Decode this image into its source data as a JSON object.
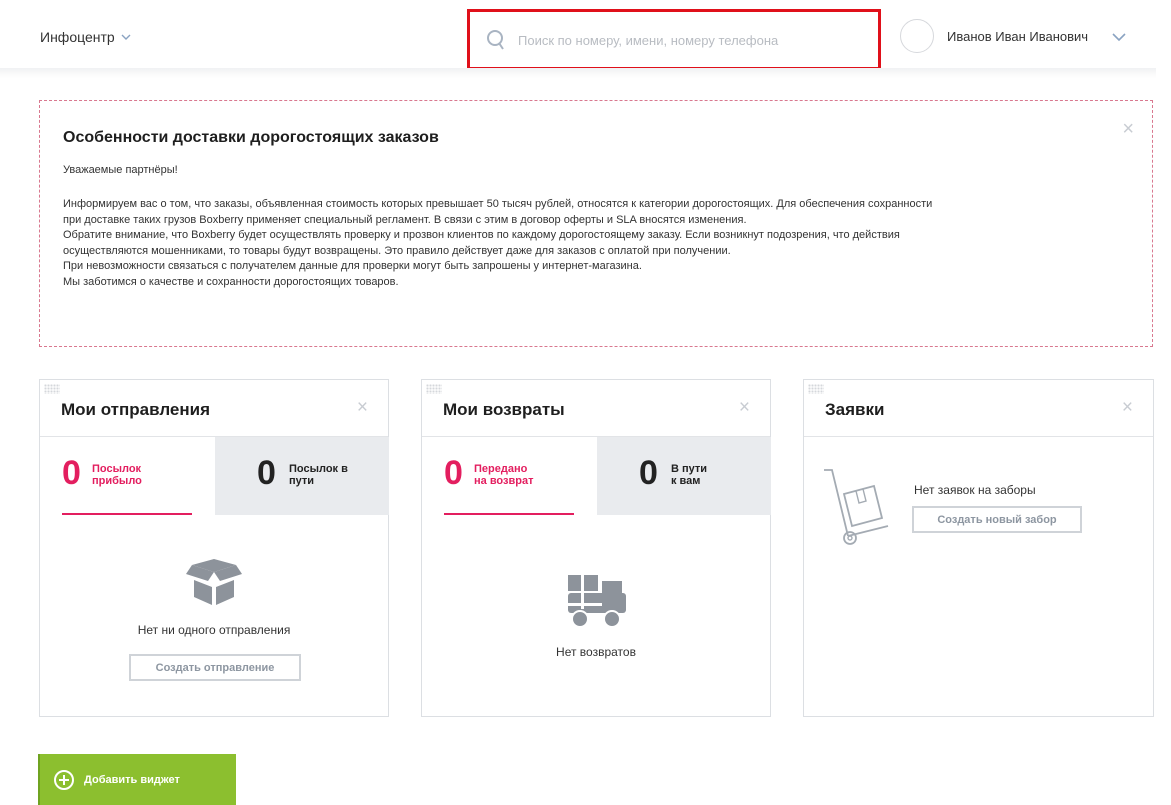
{
  "header": {
    "section_label": "Инфоцентр",
    "search_placeholder": "Поиск по номеру, имени, номеру телефона",
    "user_name": "Иванов Иван Иванович"
  },
  "notice": {
    "title": "Особенности доставки дорогостоящих заказов",
    "close": "×",
    "greeting": "Уважаемые партнёры!",
    "paragraphs": [
      "Информируем вас о том, что заказы, объявленная стоимость которых превышает 50 тысяч рублей, относятся к категории дорогостоящих. Для обеспечения сохранности",
      "при доставке таких грузов Boxberry применяет специальный регламент. В связи с этим в договор оферты и SLA вносятся изменения.",
      "Обратите внимание, что Boxberry будет осуществлять проверку и прозвон клиентов по каждому дорогостоящему заказу. Если возникнут подозрения, что действия",
      "осуществляются мошенниками, то товары будут возвращены. Это правило действует даже для заказов с оплатой при получении.",
      "При невозможности связаться с получателем данные для проверки могут быть запрошены у интернет-магазина.",
      "Мы заботимся о качестве и сохранности дорогостоящих товаров."
    ]
  },
  "widgets": {
    "shipments": {
      "title": "Мои отправления",
      "close": "×",
      "arrived_count": "0",
      "arrived_label_1": "Посылок",
      "arrived_label_2": "прибыло",
      "transit_count": "0",
      "transit_label_1": "Посылок в",
      "transit_label_2": "пути",
      "empty_text": "Нет ни одного отправления",
      "create_button": "Создать отправление"
    },
    "returns": {
      "title": "Мои возвраты",
      "close": "×",
      "returned_count": "0",
      "returned_label_1": "Передано",
      "returned_label_2": "на возврат",
      "transit_count": "0",
      "transit_label_1": "В пути",
      "transit_label_2": "к вам",
      "empty_text": "Нет возвратов"
    },
    "requests": {
      "title": "Заявки",
      "close": "×",
      "empty_text": "Нет заявок на заборы",
      "create_button": "Создать новый забор"
    }
  },
  "add_widget_label": "Добавить виджет",
  "colors": {
    "accent_pink": "#e31e5f",
    "search_highlight": "#e0101a",
    "add_widget_green": "#8cbf2f",
    "icon_gray": "#8d939b"
  }
}
